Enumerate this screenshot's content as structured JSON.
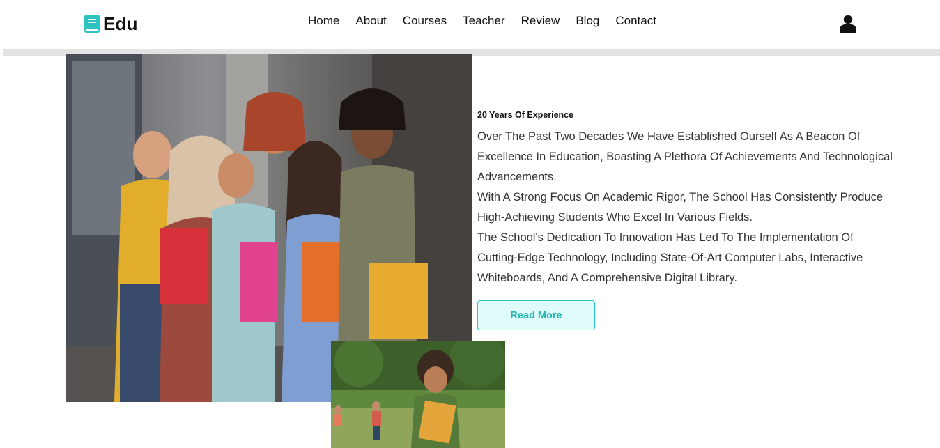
{
  "brand": {
    "name": "Edu",
    "icon": "book-icon",
    "accent": "#2bc4c0"
  },
  "nav": {
    "items": [
      {
        "label": "Home"
      },
      {
        "label": "About"
      },
      {
        "label": "Courses"
      },
      {
        "label": "Teacher"
      },
      {
        "label": "Review"
      },
      {
        "label": "Blog"
      },
      {
        "label": "Contact"
      }
    ]
  },
  "header": {
    "user_icon": "user-icon"
  },
  "about": {
    "kicker": "20 Years Of Experience",
    "paragraphs": [
      "Over The Past Two Decades We Have Established Ourself As A Beacon Of Excellence In Education, Boasting A Plethora Of Achievements And Technological Advancements.",
      "With A Strong Focus On Academic Rigor, The School Has Consistently Produce High-Achieving Students Who Excel In Various Fields.",
      "The School's Dedication To Innovation Has Led To The Implementation Of Cutting-Edge Technology, Including State-Of-Art Computer Labs, Interactive Whiteboards, And A Comprehensive Digital Library."
    ],
    "button_label": "Read More"
  }
}
